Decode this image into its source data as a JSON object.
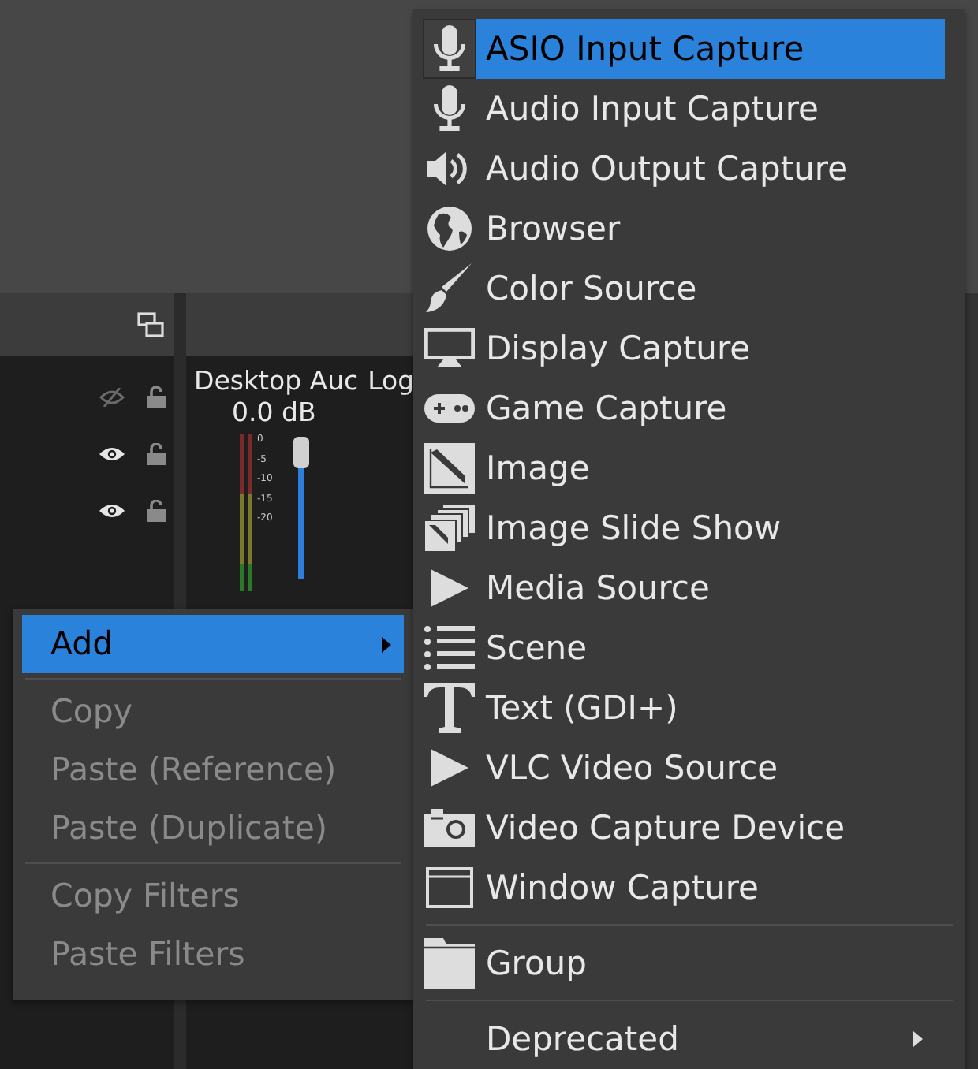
{
  "sources_panel": {
    "rows": [
      {
        "visible": false,
        "locked": false
      },
      {
        "visible": true,
        "locked": false
      },
      {
        "visible": true,
        "locked": false
      }
    ]
  },
  "mixer": {
    "channels": [
      {
        "name": "Desktop Auc",
        "reading": "0.0 dB",
        "level": 1,
        "ticks": [
          "0",
          "-5",
          "-10",
          "-15",
          "-20"
        ]
      },
      {
        "name": "Log"
      }
    ]
  },
  "context_menu": {
    "sections": [
      [
        {
          "label": "Add",
          "selected": true,
          "disabled": false,
          "submenu": true
        }
      ],
      [
        {
          "label": "Copy",
          "selected": false,
          "disabled": true,
          "submenu": false
        },
        {
          "label": "Paste (Reference)",
          "selected": false,
          "disabled": true,
          "submenu": false
        },
        {
          "label": "Paste (Duplicate)",
          "selected": false,
          "disabled": true,
          "submenu": false
        }
      ],
      [
        {
          "label": "Copy Filters",
          "selected": false,
          "disabled": true,
          "submenu": false
        },
        {
          "label": "Paste Filters",
          "selected": false,
          "disabled": true,
          "submenu": false
        }
      ]
    ]
  },
  "add_submenu": {
    "sections": [
      [
        {
          "label": "ASIO Input Capture",
          "kind": "mic",
          "selected": true
        },
        {
          "label": "Audio Input Capture",
          "kind": "mic",
          "selected": false
        },
        {
          "label": "Audio Output Capture",
          "kind": "speaker",
          "selected": false
        },
        {
          "label": "Browser",
          "kind": "globe",
          "selected": false
        },
        {
          "label": "Color Source",
          "kind": "brush",
          "selected": false
        },
        {
          "label": "Display Capture",
          "kind": "monitor",
          "selected": false
        },
        {
          "label": "Game Capture",
          "kind": "gamepad",
          "selected": false
        },
        {
          "label": "Image",
          "kind": "image",
          "selected": false
        },
        {
          "label": "Image Slide Show",
          "kind": "slides",
          "selected": false
        },
        {
          "label": "Media Source",
          "kind": "play",
          "selected": false
        },
        {
          "label": "Scene",
          "kind": "list",
          "selected": false
        },
        {
          "label": "Text (GDI+)",
          "kind": "text",
          "selected": false
        },
        {
          "label": "VLC Video Source",
          "kind": "play",
          "selected": false
        },
        {
          "label": "Video Capture Device",
          "kind": "camera",
          "selected": false
        },
        {
          "label": "Window Capture",
          "kind": "window",
          "selected": false
        }
      ],
      [
        {
          "label": "Group",
          "kind": "folder",
          "selected": false
        }
      ],
      [
        {
          "label": "Deprecated",
          "kind": "submenu",
          "selected": false
        }
      ]
    ]
  }
}
